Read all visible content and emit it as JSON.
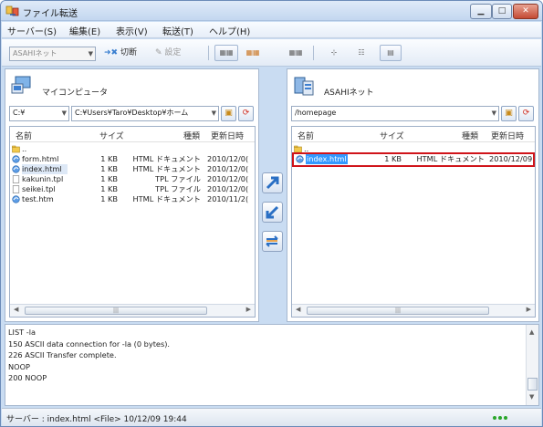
{
  "window": {
    "title": "ファイル転送"
  },
  "menu": [
    "サーバー(S)",
    "編集(E)",
    "表示(V)",
    "転送(T)",
    "ヘルプ(H)"
  ],
  "toolbar": {
    "server_combo": "ASAHIネット",
    "disconnect_label": "切断",
    "settings_label": "設定"
  },
  "left": {
    "title": "マイコンピュータ",
    "drive": "C:¥",
    "path": "C:¥Users¥Taro¥Desktop¥ホーム",
    "columns": [
      "名前",
      "サイズ",
      "種類",
      "更新日時"
    ],
    "rows": [
      {
        "name": "..",
        "size": "",
        "type": "",
        "date": ""
      },
      {
        "name": "form.html",
        "size": "1 KB",
        "type": "HTML ドキュメント",
        "date": "2010/12/0("
      },
      {
        "name": "index.html",
        "size": "1 KB",
        "type": "HTML ドキュメント",
        "date": "2010/12/0("
      },
      {
        "name": "kakunin.tpl",
        "size": "1 KB",
        "type": "TPL ファイル",
        "date": "2010/12/0("
      },
      {
        "name": "seikei.tpl",
        "size": "1 KB",
        "type": "TPL ファイル",
        "date": "2010/12/0("
      },
      {
        "name": "test.htm",
        "size": "1 KB",
        "type": "HTML ドキュメント",
        "date": "2010/11/2("
      }
    ]
  },
  "right": {
    "title": "ASAHIネット",
    "path": "/homepage",
    "columns": [
      "名前",
      "サイズ",
      "種類",
      "更新日時"
    ],
    "rows": [
      {
        "name": "..",
        "size": "",
        "type": "",
        "date": ""
      },
      {
        "name": "index.html",
        "size": "1 KB",
        "type": "HTML ドキュメント",
        "date": "2010/12/09"
      }
    ]
  },
  "log": [
    "LIST -la",
    "150  ASCII data connection for -la (0 bytes).",
    "226  ASCII Transfer complete.",
    "NOOP",
    "200  NOOP"
  ],
  "status": "サーバー : index.html <File> 10/12/09 19:44",
  "colors": {
    "highlight_border": "#d0141a",
    "selection": "#3399ff"
  }
}
